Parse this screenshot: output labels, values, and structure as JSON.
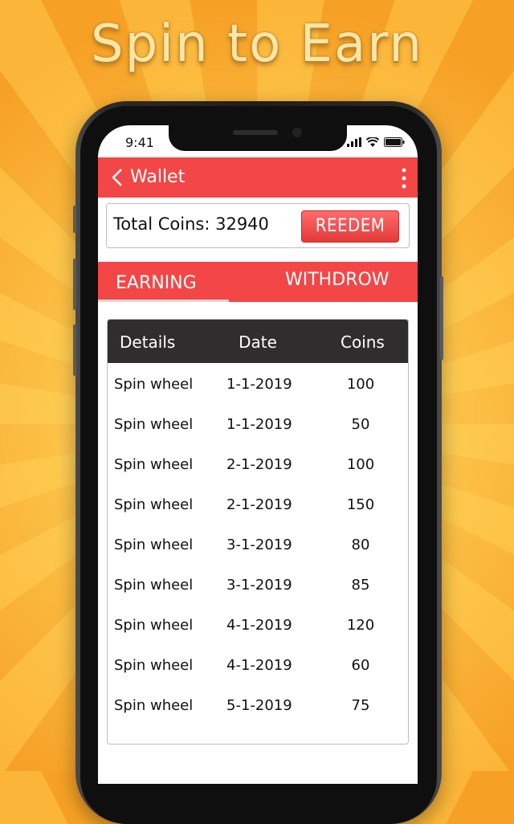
{
  "banner": {
    "headline": "Spin to Earn"
  },
  "status_bar": {
    "time": "9:41"
  },
  "topbar": {
    "title": "Wallet"
  },
  "wallet": {
    "total_coins_label": "Total Coins:",
    "total_coins": "32940",
    "redeem_label": "REEDEM"
  },
  "tabs": [
    {
      "label": "EARNING",
      "selected": true
    },
    {
      "label": "WITHDROW",
      "selected": false
    }
  ],
  "table": {
    "headers": [
      "Details",
      "Date",
      "Coins"
    ],
    "rows": [
      {
        "details": "Spin wheel",
        "date": "1-1-2019",
        "coins": "100"
      },
      {
        "details": "Spin wheel",
        "date": "1-1-2019",
        "coins": "50"
      },
      {
        "details": "Spin wheel",
        "date": "2-1-2019",
        "coins": "100"
      },
      {
        "details": "Spin wheel",
        "date": "2-1-2019",
        "coins": "150"
      },
      {
        "details": "Spin wheel",
        "date": "3-1-2019",
        "coins": "80"
      },
      {
        "details": "Spin wheel",
        "date": "3-1-2019",
        "coins": "85"
      },
      {
        "details": "Spin wheel",
        "date": "4-1-2019",
        "coins": "120"
      },
      {
        "details": "Spin wheel",
        "date": "4-1-2019",
        "coins": "60"
      },
      {
        "details": "Spin wheel",
        "date": "5-1-2019",
        "coins": "75"
      }
    ]
  },
  "colors": {
    "accent": "#f34646",
    "table_header": "#2f2d2d",
    "headline": "#fbe6a8"
  },
  "icons": [
    "back-arrow-icon",
    "more-vert-icon",
    "signal-icon",
    "wifi-icon",
    "battery-icon"
  ]
}
